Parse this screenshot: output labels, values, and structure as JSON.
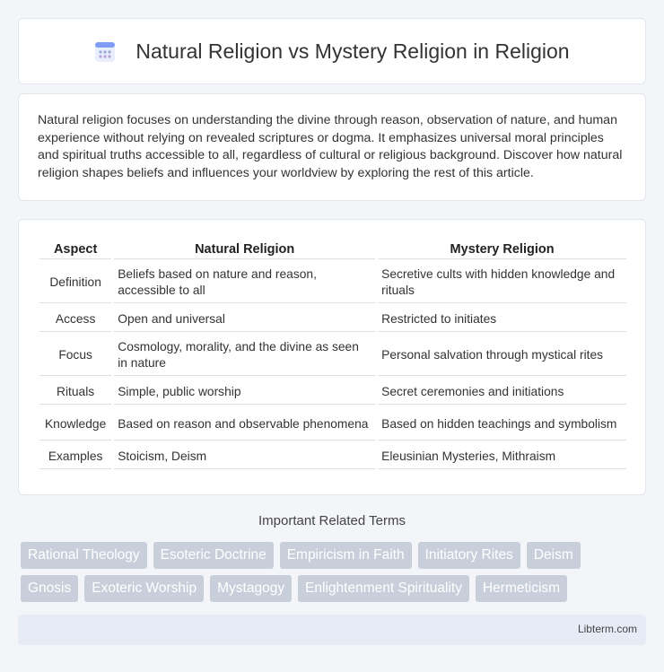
{
  "header": {
    "title": "Natural Religion vs Mystery Religion in Religion",
    "icon": "calendar-grid-icon"
  },
  "intro": {
    "text": "Natural religion focuses on understanding the divine through reason, observation of nature, and human experience without relying on revealed scriptures or dogma. It emphasizes universal moral principles and spiritual truths accessible to all, regardless of cultural or religious background. Discover how natural religion shapes beliefs and influences your worldview by exploring the rest of this article."
  },
  "table": {
    "headers": [
      "Aspect",
      "Natural Religion",
      "Mystery Religion"
    ],
    "rows": [
      [
        "Definition",
        "Beliefs based on nature and reason, accessible to all",
        "Secretive cults with hidden knowledge and rituals"
      ],
      [
        "Access",
        "Open and universal",
        "Restricted to initiates"
      ],
      [
        "Focus",
        "Cosmology, morality, and the divine as seen in nature",
        "Personal salvation through mystical rites"
      ],
      [
        "Rituals",
        "Simple, public worship",
        "Secret ceremonies and initiations"
      ],
      [
        "Knowledge",
        "Based on reason and observable phenomena",
        "Based on hidden teachings and symbolism"
      ],
      [
        "Examples",
        "Stoicism, Deism",
        "Eleusinian Mysteries, Mithraism"
      ]
    ]
  },
  "related": {
    "title": "Important Related Terms",
    "tags_row1": [
      "Rational Theology",
      "Esoteric Doctrine",
      "Empiricism in Faith",
      "Initiatory Rites",
      "Deism"
    ],
    "tags_row2": [
      "Gnosis",
      "Exoteric Worship",
      "Mystagogy",
      "Enlightenment Spirituality",
      "Hermeticism"
    ]
  },
  "footer": {
    "site": "Libterm.com"
  }
}
